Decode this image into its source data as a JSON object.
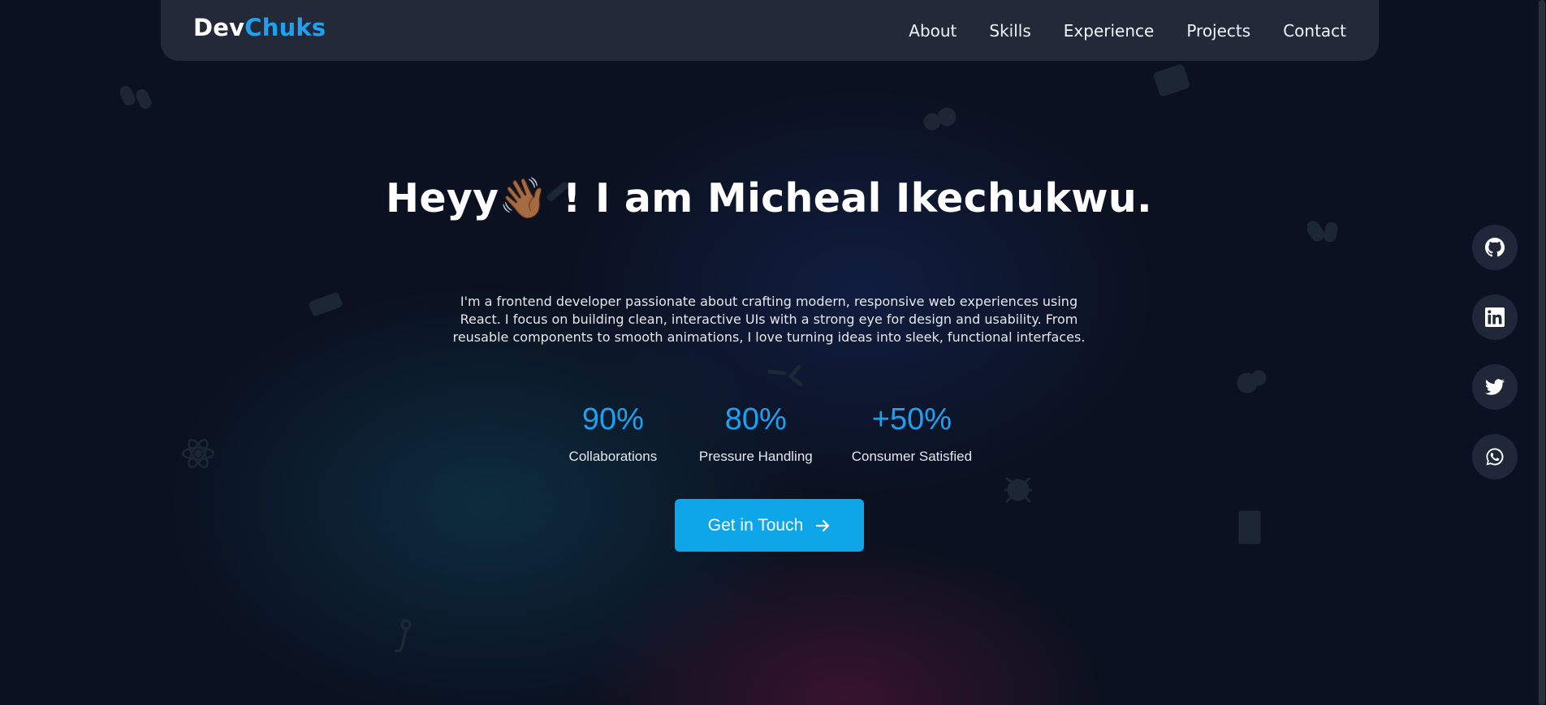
{
  "nav": {
    "logo_prefix": "Dev",
    "logo_accent": "Chuks",
    "links": [
      {
        "label": "About"
      },
      {
        "label": "Skills"
      },
      {
        "label": "Experience"
      },
      {
        "label": "Projects"
      },
      {
        "label": "Contact"
      }
    ]
  },
  "hero": {
    "title_part1": "Heyy",
    "wave_emoji": "👋🏾",
    "title_part2": "! I am Micheal Ikechukwu.",
    "description": "I'm a frontend developer passionate about crafting modern, responsive web experiences using React. I focus on building clean, interactive UIs with a strong eye for design and usability. From reusable components to smooth animations, I love turning ideas into sleek, functional interfaces.",
    "stats": [
      {
        "value": "90%",
        "label": "Collaborations"
      },
      {
        "value": "80%",
        "label": "Pressure Handling"
      },
      {
        "value": "+50%",
        "label": "Consumer Satisfied"
      }
    ],
    "cta_label": "Get in Touch"
  },
  "socials": [
    {
      "icon": "github-icon"
    },
    {
      "icon": "linkedin-icon"
    },
    {
      "icon": "twitter-icon"
    },
    {
      "icon": "whatsapp-icon"
    }
  ],
  "colors": {
    "background": "#0b1120",
    "navbar": "#232938",
    "accent": "#1da1f2",
    "cta": "#0ea5e9",
    "social_bg": "#1f2738"
  }
}
